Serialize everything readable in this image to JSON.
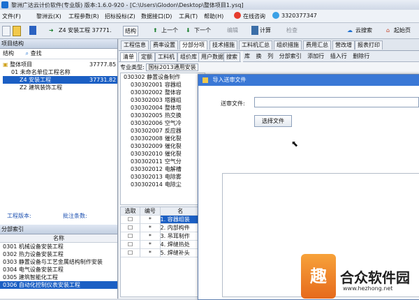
{
  "window": {
    "title": "黎洲广达云计价软件(专业版) 版本:1.6.0-920 - [C:\\Users\\Glodon\\Desktop\\整体项目1.ysq]"
  },
  "menu": [
    "文件(F)",
    "黎洲云(X)",
    "工程参数(R)",
    "招标投标(Z)",
    "数据接口(D)",
    "工具(T)",
    "帮助(H)",
    "在线咨询",
    "3320377347"
  ],
  "toolbar": {
    "breadcrumb": "Z4  安装工程 37771.",
    "structure": "结构",
    "prev": "上一个",
    "next": "下一个",
    "edit": "编辑",
    "calc": "计算",
    "check": "检查",
    "cloud_search": "云搜索",
    "start_page": "起始页"
  },
  "left_pane": {
    "title": "项目结构",
    "tab1": "结构",
    "tab2": "查找",
    "tree": [
      {
        "code": "",
        "name": "整体项目",
        "value": "37777.85"
      },
      {
        "code": "01",
        "name": "未命名单位工程名称",
        "value": ""
      },
      {
        "code": "Z4",
        "name": "安装工程",
        "value": "37731.82"
      },
      {
        "code": "Z2",
        "name": "建筑装饰工程",
        "value": ""
      }
    ],
    "info_label1": "工程版本:",
    "info_label2": "批注条数:",
    "index_title": "分部索引",
    "index_header": "名称",
    "index_rows": [
      {
        "code": "0301",
        "name": "机械设备安装工程"
      },
      {
        "code": "0302",
        "name": "热力设备安装工程"
      },
      {
        "code": "0303",
        "name": "静置设备与工艺金属结构制作安装"
      },
      {
        "code": "0304",
        "name": "电气设备安装工程"
      },
      {
        "code": "0305",
        "name": "建筑智能化工程"
      },
      {
        "code": "0306",
        "name": "自动化控制仪表安装工程"
      }
    ]
  },
  "mid": {
    "tabs": [
      "工程信息",
      "费率设置",
      "分部分项",
      "技术措施",
      "工料机汇总",
      "组织措施",
      "费用汇总",
      "营改增",
      "报表打印"
    ],
    "subtabs": [
      "清单",
      "定额",
      "工料机",
      "组价库",
      "用户数据",
      "搜索"
    ],
    "right_tools": [
      "库",
      "换",
      "列",
      "分部索引",
      "添加行",
      "插入行",
      "删除行"
    ],
    "prof_type_label": "专业类型",
    "prof_type_value": "国标2013通用安装",
    "tree_parent": "030302  静置设备制作",
    "tree_items": [
      {
        "code": "030302001",
        "name": "容器组"
      },
      {
        "code": "030302002",
        "name": "整体容"
      },
      {
        "code": "030302003",
        "name": "塔器组"
      },
      {
        "code": "030302004",
        "name": "整体塔"
      },
      {
        "code": "030302005",
        "name": "热交换"
      },
      {
        "code": "030302006",
        "name": "空气冷"
      },
      {
        "code": "030302007",
        "name": "反应器"
      },
      {
        "code": "030302008",
        "name": "催化裂"
      },
      {
        "code": "030302009",
        "name": "催化裂"
      },
      {
        "code": "030302010",
        "name": "催化裂"
      },
      {
        "code": "030302011",
        "name": "空气分"
      },
      {
        "code": "030302012",
        "name": "电解槽"
      },
      {
        "code": "030302013",
        "name": "电除雾"
      },
      {
        "code": "030302014",
        "name": "电除尘"
      }
    ],
    "grid_headers": [
      "选取",
      "编号",
      "名"
    ],
    "grid_rows": [
      {
        "no": "*",
        "name": "1. 容器组装"
      },
      {
        "no": "*",
        "name": "2. 内部构件"
      },
      {
        "no": "*",
        "name": "3. 吊耳制作"
      },
      {
        "no": "*",
        "name": "4. 焊缝热处"
      },
      {
        "no": "*",
        "name": "5. 焊缝补头"
      }
    ]
  },
  "dialog": {
    "title": "导入送审文件",
    "field_label": "送审文件:",
    "field_value": "",
    "button": "选择文件"
  },
  "watermark": {
    "text": "合众软件园",
    "url": "www.hezhong.net",
    "badge": "趣"
  }
}
